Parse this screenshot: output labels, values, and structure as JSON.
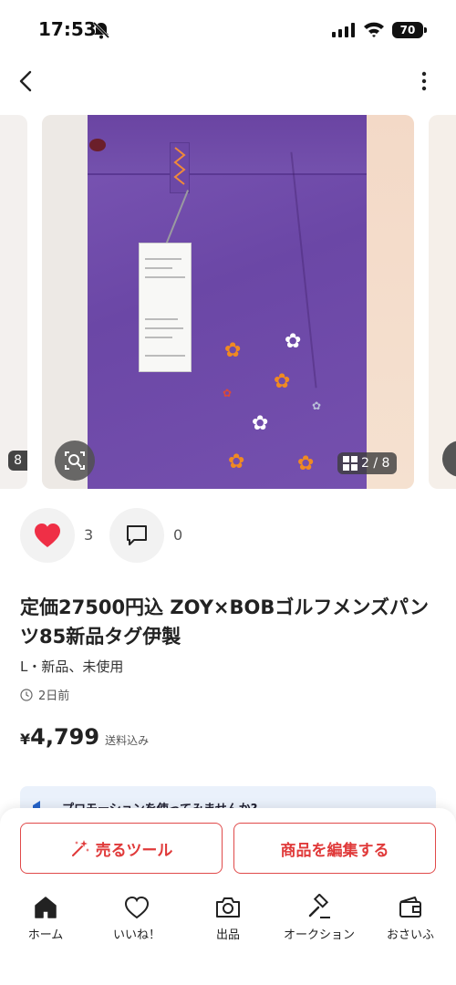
{
  "status_bar": {
    "time": "17:53",
    "battery": "70"
  },
  "carousel": {
    "page_indicator": "2 / 8",
    "prev_count": "8"
  },
  "actions": {
    "like_count": "3",
    "comment_count": "0"
  },
  "product": {
    "title": "定価27500円込 ZOY×BOBゴルフメンズパンツ85新品タグ伊製",
    "condition": "L・新品、未使用",
    "posted": "2日前",
    "price_symbol": "¥",
    "price": "4,799",
    "shipping": "送料込み"
  },
  "promo": {
    "text": "プロモーションを使ってみませんか?"
  },
  "buttons": {
    "sell_tool": "売るツール",
    "edit_item": "商品を編集する"
  },
  "tabbar": {
    "items": [
      {
        "label": "ホーム",
        "icon": "home-icon"
      },
      {
        "label": "いいね！",
        "icon": "heart-outline-icon"
      },
      {
        "label": "出品",
        "icon": "camera-icon"
      },
      {
        "label": "オークション",
        "icon": "gavel-icon"
      },
      {
        "label": "おさいふ",
        "icon": "wallet-icon"
      }
    ]
  },
  "colors": {
    "accent": "#e03a3a",
    "like": "#ef2f46",
    "promo_bg": "#eaf1fb"
  }
}
